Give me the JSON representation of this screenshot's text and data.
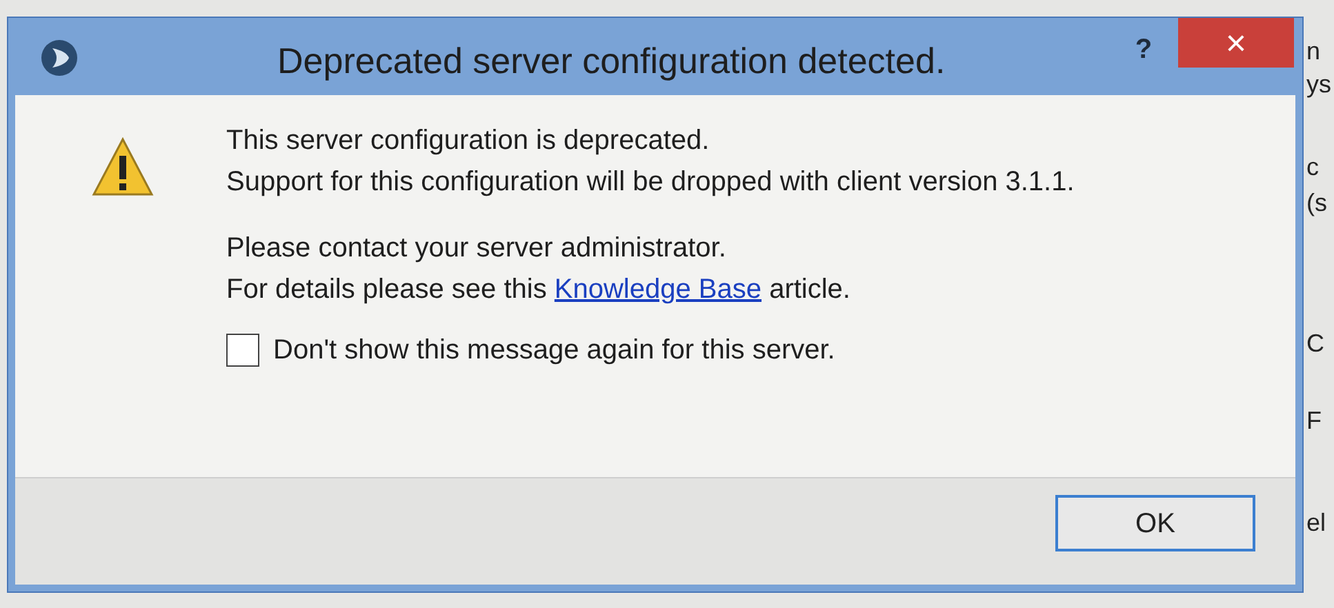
{
  "background_fragments": [
    {
      "text": "n"
    },
    {
      "text": "ys"
    },
    {
      "text": "c"
    },
    {
      "text": "(s"
    },
    {
      "text": "C"
    },
    {
      "text": "F"
    },
    {
      "text": "el"
    }
  ],
  "dialog": {
    "title": "Deprecated server configuration detected.",
    "help": "?",
    "close": "×",
    "lines": [
      "This server configuration is deprecated.",
      "Support for this configuration will be dropped with client version 3.1.1."
    ],
    "contact": "Please contact your server administrator.",
    "details_before": "For details please see this",
    "link": "Knowledge Base",
    "details_after": "article.",
    "checkbox": {
      "label": "Don't show this message again for this server.",
      "checked": false
    },
    "buttons": [
      {
        "label": "OK",
        "default": true
      }
    ]
  }
}
